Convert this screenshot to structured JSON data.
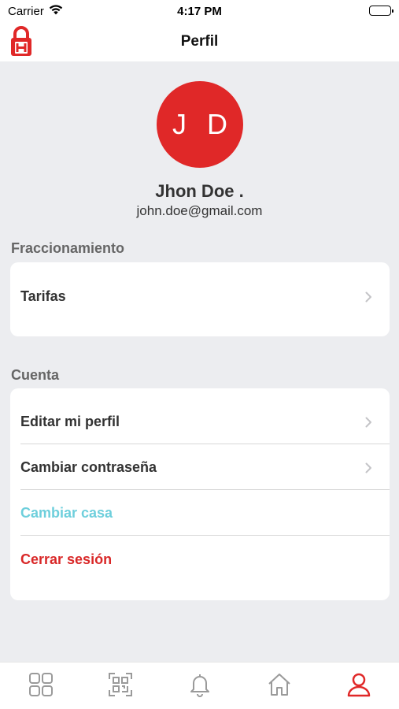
{
  "status_bar": {
    "carrier": "Carrier",
    "time": "4:17 PM"
  },
  "header": {
    "title": "Perfil",
    "logo_icon": "lock-house-logo-icon"
  },
  "profile": {
    "initials": "J D",
    "name": "Jhon Doe .",
    "email": "john.doe@gmail.com",
    "avatar_color": "#e02828"
  },
  "sections": {
    "fraccionamiento": {
      "title": "Fraccionamiento",
      "items": [
        {
          "label": "Tarifas"
        }
      ]
    },
    "cuenta": {
      "title": "Cuenta",
      "items": [
        {
          "label": "Editar mi perfil"
        },
        {
          "label": "Cambiar contraseña"
        },
        {
          "label": "Cambiar casa",
          "color": "#6ecfdc"
        },
        {
          "label": "Cerrar sesión",
          "color": "#d92828"
        }
      ]
    }
  },
  "tab_bar": {
    "active_color": "#e02828",
    "tabs": [
      "dashboard-icon",
      "qr-code-icon",
      "bell-icon",
      "home-icon",
      "user-icon"
    ],
    "active": "user-icon"
  }
}
